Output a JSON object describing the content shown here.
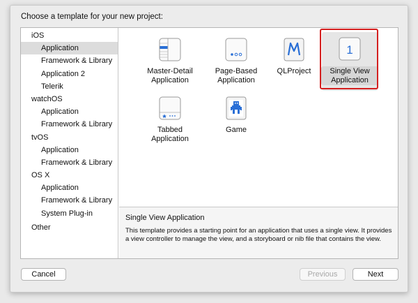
{
  "dialog": {
    "prompt": "Choose a template for your new project:"
  },
  "sidebar": {
    "items": [
      {
        "label": "iOS",
        "level": "category"
      },
      {
        "label": "Application",
        "level": "sub",
        "selected": true
      },
      {
        "label": "Framework & Library",
        "level": "sub"
      },
      {
        "label": "Application 2",
        "level": "sub"
      },
      {
        "label": "Telerik",
        "level": "sub"
      },
      {
        "label": "watchOS",
        "level": "category"
      },
      {
        "label": "Application",
        "level": "sub"
      },
      {
        "label": "Framework & Library",
        "level": "sub"
      },
      {
        "label": "tvOS",
        "level": "category"
      },
      {
        "label": "Application",
        "level": "sub"
      },
      {
        "label": "Framework & Library",
        "level": "sub"
      },
      {
        "label": "OS X",
        "level": "category"
      },
      {
        "label": "Application",
        "level": "sub"
      },
      {
        "label": "Framework & Library",
        "level": "sub"
      },
      {
        "label": "System Plug-in",
        "level": "sub"
      },
      {
        "label": "Other",
        "level": "category"
      }
    ]
  },
  "templates": [
    {
      "label": "Master-Detail Application",
      "icon": "master-detail-icon"
    },
    {
      "label": "Page-Based Application",
      "icon": "page-based-icon"
    },
    {
      "label": "QLProject",
      "icon": "qlproject-icon"
    },
    {
      "label": "Single View Application",
      "icon": "single-view-icon",
      "selected": true,
      "icon_text": "1"
    },
    {
      "label": "Tabbed Application",
      "icon": "tabbed-icon"
    },
    {
      "label": "Game",
      "icon": "game-icon"
    }
  ],
  "description": {
    "title": "Single View Application",
    "text": "This template provides a starting point for an application that uses a single view. It provides a view controller to manage the view, and a storyboard or nib file that contains the view."
  },
  "buttons": {
    "cancel": "Cancel",
    "previous": "Previous",
    "next": "Next"
  },
  "colors": {
    "highlight": "#d41f1f",
    "icon_blue": "#2a6fd6",
    "selection": "#dcdcdc"
  }
}
